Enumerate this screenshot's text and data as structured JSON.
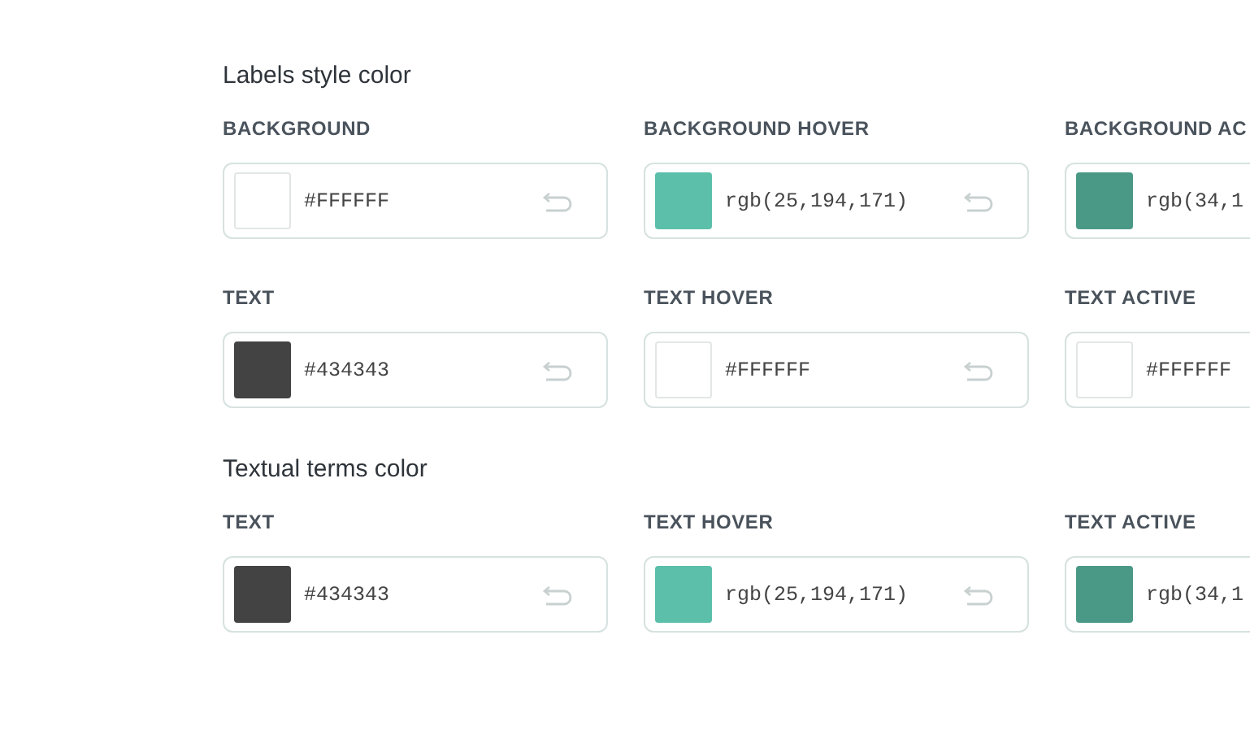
{
  "sections": [
    {
      "title": "Labels style color",
      "rows": [
        [
          {
            "label": "BACKGROUND",
            "value": "#FFFFFF",
            "color": "#ffffff",
            "kind": "full"
          },
          {
            "label": "BACKGROUND HOVER",
            "value": "rgb(25,194,171)",
            "color": "#5bbfaa",
            "kind": "full"
          },
          {
            "label": "BACKGROUND AC",
            "value": "rgb(34,1",
            "color": "#4a9987",
            "kind": "cut"
          }
        ],
        [
          {
            "label": "TEXT",
            "value": "#434343",
            "color": "#434343",
            "kind": "full"
          },
          {
            "label": "TEXT HOVER",
            "value": "#FFFFFF",
            "color": "#ffffff",
            "kind": "full"
          },
          {
            "label": "TEXT ACTIVE",
            "value": "#FFFFFF",
            "color": "#ffffff",
            "kind": "cut"
          }
        ]
      ]
    },
    {
      "title": "Textual terms color",
      "rows": [
        [
          {
            "label": "TEXT",
            "value": "#434343",
            "color": "#434343",
            "kind": "full"
          },
          {
            "label": "TEXT HOVER",
            "value": "rgb(25,194,171)",
            "color": "#5bbfaa",
            "kind": "full"
          },
          {
            "label": "TEXT ACTIVE",
            "value": "rgb(34,1",
            "color": "#4a9987",
            "kind": "cut"
          }
        ]
      ]
    }
  ]
}
